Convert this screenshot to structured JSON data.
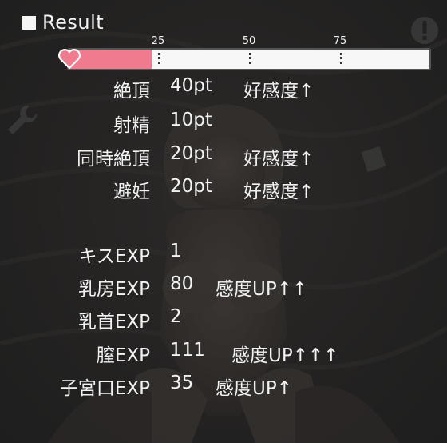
{
  "title": "Result",
  "gauge": {
    "ticks": [
      "25",
      "50",
      "75"
    ],
    "fill_fraction": 0.23,
    "fill_color": "#f07a8e",
    "heart_color": "#f07a8e"
  },
  "stats": [
    {
      "label": "絶頂",
      "value": "40pt",
      "note": "好感度↑"
    },
    {
      "label": "射精",
      "value": "10pt",
      "note": ""
    },
    {
      "label": "同時絶頂",
      "value": "20pt",
      "note": "好感度↑"
    },
    {
      "label": "避妊",
      "value": "20pt",
      "note": "好感度↑"
    }
  ],
  "exp": [
    {
      "label": "キスEXP",
      "value": "1",
      "note": ""
    },
    {
      "label": "乳房EXP",
      "value": "80",
      "note": "感度UP↑↑"
    },
    {
      "label": "乳首EXP",
      "value": "2",
      "note": ""
    },
    {
      "label": "膣EXP",
      "value": "111",
      "note": "感度UP↑↑↑"
    },
    {
      "label": "子宮口EXP",
      "value": "35",
      "note": "感度UP↑"
    }
  ],
  "icons": [
    "wrench-icon",
    "warning-icon",
    "heart-icon"
  ]
}
